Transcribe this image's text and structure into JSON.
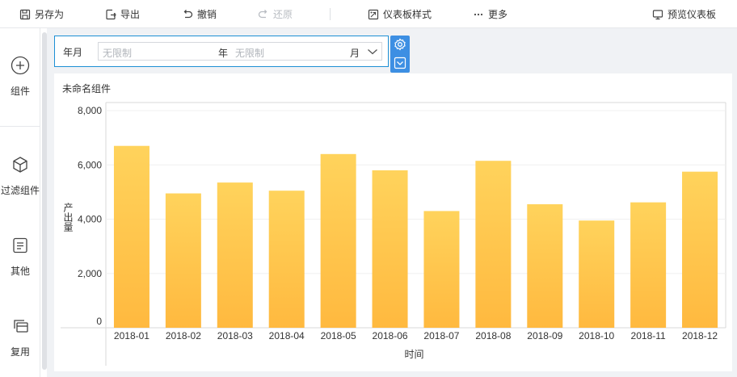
{
  "toolbar": {
    "save_as": "另存为",
    "export": "导出",
    "undo": "撤销",
    "redo": "还原",
    "dashboard_style": "仪表板样式",
    "more": "更多",
    "preview": "预览仪表板"
  },
  "sidebar": {
    "items": [
      {
        "label": "组件",
        "icon": "add-circle-icon"
      },
      {
        "label": "过滤组件",
        "icon": "cube-icon"
      },
      {
        "label": "其他",
        "icon": "document-icon"
      },
      {
        "label": "复用",
        "icon": "copy-icon"
      }
    ]
  },
  "filter": {
    "label": "年月",
    "year_placeholder": "无限制",
    "year_unit": "年",
    "month_placeholder": "无限制",
    "month_unit": "月"
  },
  "widget": {
    "title": "未命名组件"
  },
  "colors": {
    "accent": "#1d8fd5",
    "bar_top": "#ffd35c",
    "bar_bottom": "#ffb93f"
  },
  "chart_data": {
    "type": "bar",
    "categories": [
      "2018-01",
      "2018-02",
      "2018-03",
      "2018-04",
      "2018-05",
      "2018-06",
      "2018-07",
      "2018-08",
      "2018-09",
      "2018-10",
      "2018-11",
      "2018-12"
    ],
    "series": [
      {
        "values": [
          6700,
          4950,
          5350,
          5050,
          6400,
          5800,
          4300,
          6150,
          4550,
          3950,
          4620,
          5750
        ]
      }
    ],
    "xlabel": "时间",
    "ylabel": "产出量",
    "ylim": [
      0,
      8000
    ],
    "yticks": [
      "0",
      "2,000",
      "4,000",
      "6,000",
      "8,000"
    ],
    "grid": true
  }
}
